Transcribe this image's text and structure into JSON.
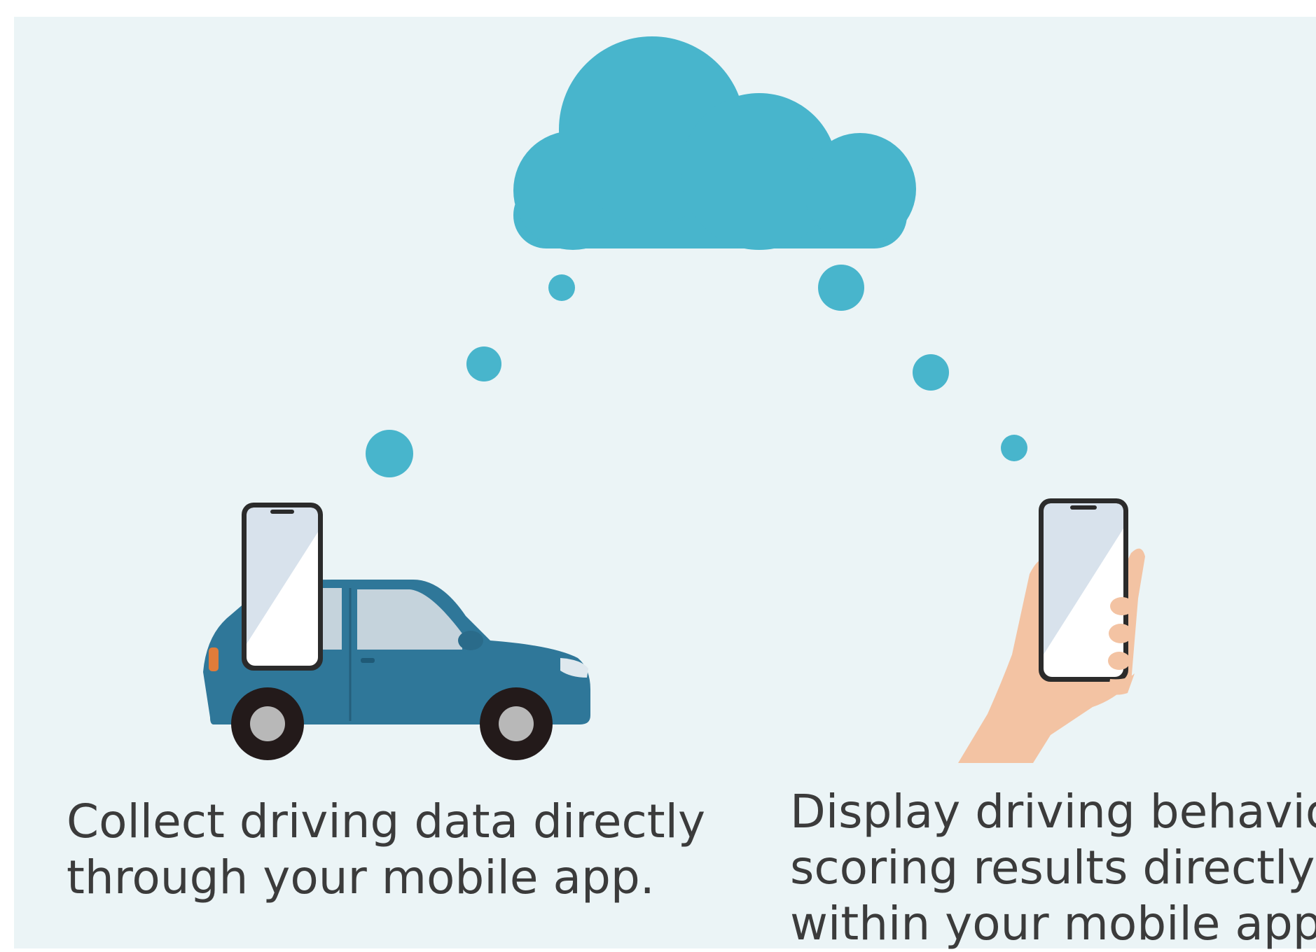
{
  "colors": {
    "background": "#ebf4f6",
    "cloud": "#48b5cc",
    "dots": "#48b5cc",
    "car_body": "#2f7799",
    "skin": "#f3c3a3",
    "text": "#3b3b3b"
  },
  "icons": [
    "cloud-icon",
    "car-icon",
    "phone-icon",
    "hand-icon"
  ],
  "captions": {
    "left": {
      "line1": "Collect driving data directly",
      "line2": "through your mobile app."
    },
    "right": {
      "line1": "Display driving behavior",
      "line2": "scoring results directly",
      "line3": "within your mobile app."
    }
  }
}
